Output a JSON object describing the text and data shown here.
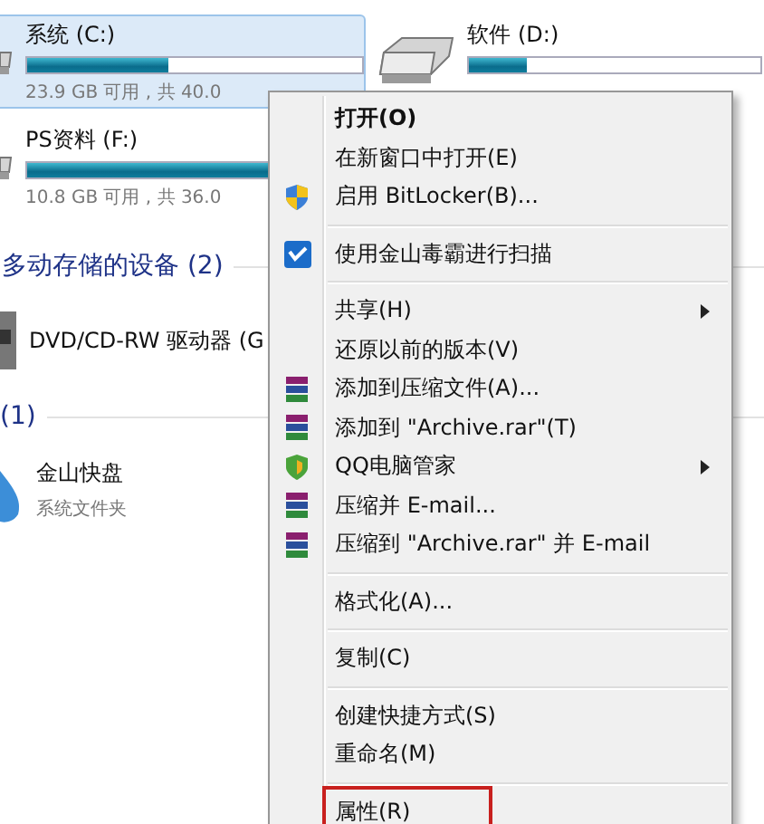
{
  "drives_top": [
    {
      "name": "系统 (C:)",
      "level": 0.42,
      "free": "23.9 GB 可用 , 共 40.0",
      "selected": true
    },
    {
      "name": "软件 (D:)",
      "level": 0.2,
      "selected": false
    }
  ],
  "drive_f": {
    "name": "PS资料 (F:)",
    "level": 0.75,
    "free": "10.8 GB 可用 , 共 36.0",
    "selected": false
  },
  "removable_section": {
    "title": "多动存储的设备 (2)",
    "device": "DVD/CD-RW 驱动器 (G"
  },
  "other_section": {
    "title": "(1)",
    "item_name": "金山快盘",
    "item_type": "系统文件夹"
  },
  "context_menu": [
    {
      "kind": "item",
      "label": "打开(O)",
      "bold": true,
      "submenu": false,
      "highlighted": false
    },
    {
      "kind": "item",
      "label": "在新窗口中打开(E)",
      "bold": false,
      "submenu": false,
      "highlighted": false
    },
    {
      "kind": "item",
      "label": "启用 BitLocker(B)...",
      "bold": false,
      "submenu": false,
      "highlighted": false
    },
    {
      "kind": "separator"
    },
    {
      "kind": "item",
      "label": "使用金山毒霸进行扫描",
      "bold": false,
      "submenu": false,
      "highlighted": false
    },
    {
      "kind": "separator"
    },
    {
      "kind": "item",
      "label": "共享(H)",
      "bold": false,
      "submenu": true,
      "highlighted": false
    },
    {
      "kind": "item",
      "label": "还原以前的版本(V)",
      "bold": false,
      "submenu": false,
      "highlighted": false
    },
    {
      "kind": "item",
      "label": "添加到压缩文件(A)...",
      "bold": false,
      "submenu": false,
      "highlighted": false
    },
    {
      "kind": "item",
      "label": "添加到 \"Archive.rar\"(T)",
      "bold": false,
      "submenu": false,
      "highlighted": false
    },
    {
      "kind": "item",
      "label": "QQ电脑管家",
      "bold": false,
      "submenu": true,
      "highlighted": false
    },
    {
      "kind": "item",
      "label": "压缩并 E-mail...",
      "bold": false,
      "submenu": false,
      "highlighted": false
    },
    {
      "kind": "item",
      "label": "压缩到 \"Archive.rar\" 并 E-mail",
      "bold": false,
      "submenu": false,
      "highlighted": false
    },
    {
      "kind": "separator"
    },
    {
      "kind": "item",
      "label": "格式化(A)...",
      "bold": false,
      "submenu": false,
      "highlighted": false
    },
    {
      "kind": "separator"
    },
    {
      "kind": "item",
      "label": "复制(C)",
      "bold": false,
      "submenu": false,
      "highlighted": false
    },
    {
      "kind": "separator"
    },
    {
      "kind": "item",
      "label": "创建快捷方式(S)",
      "bold": false,
      "submenu": false,
      "highlighted": false
    },
    {
      "kind": "item",
      "label": "重命名(M)",
      "bold": false,
      "submenu": false,
      "highlighted": false
    },
    {
      "kind": "separator"
    },
    {
      "kind": "item",
      "label": "属性(R)",
      "bold": false,
      "submenu": false,
      "highlighted": true
    }
  ]
}
